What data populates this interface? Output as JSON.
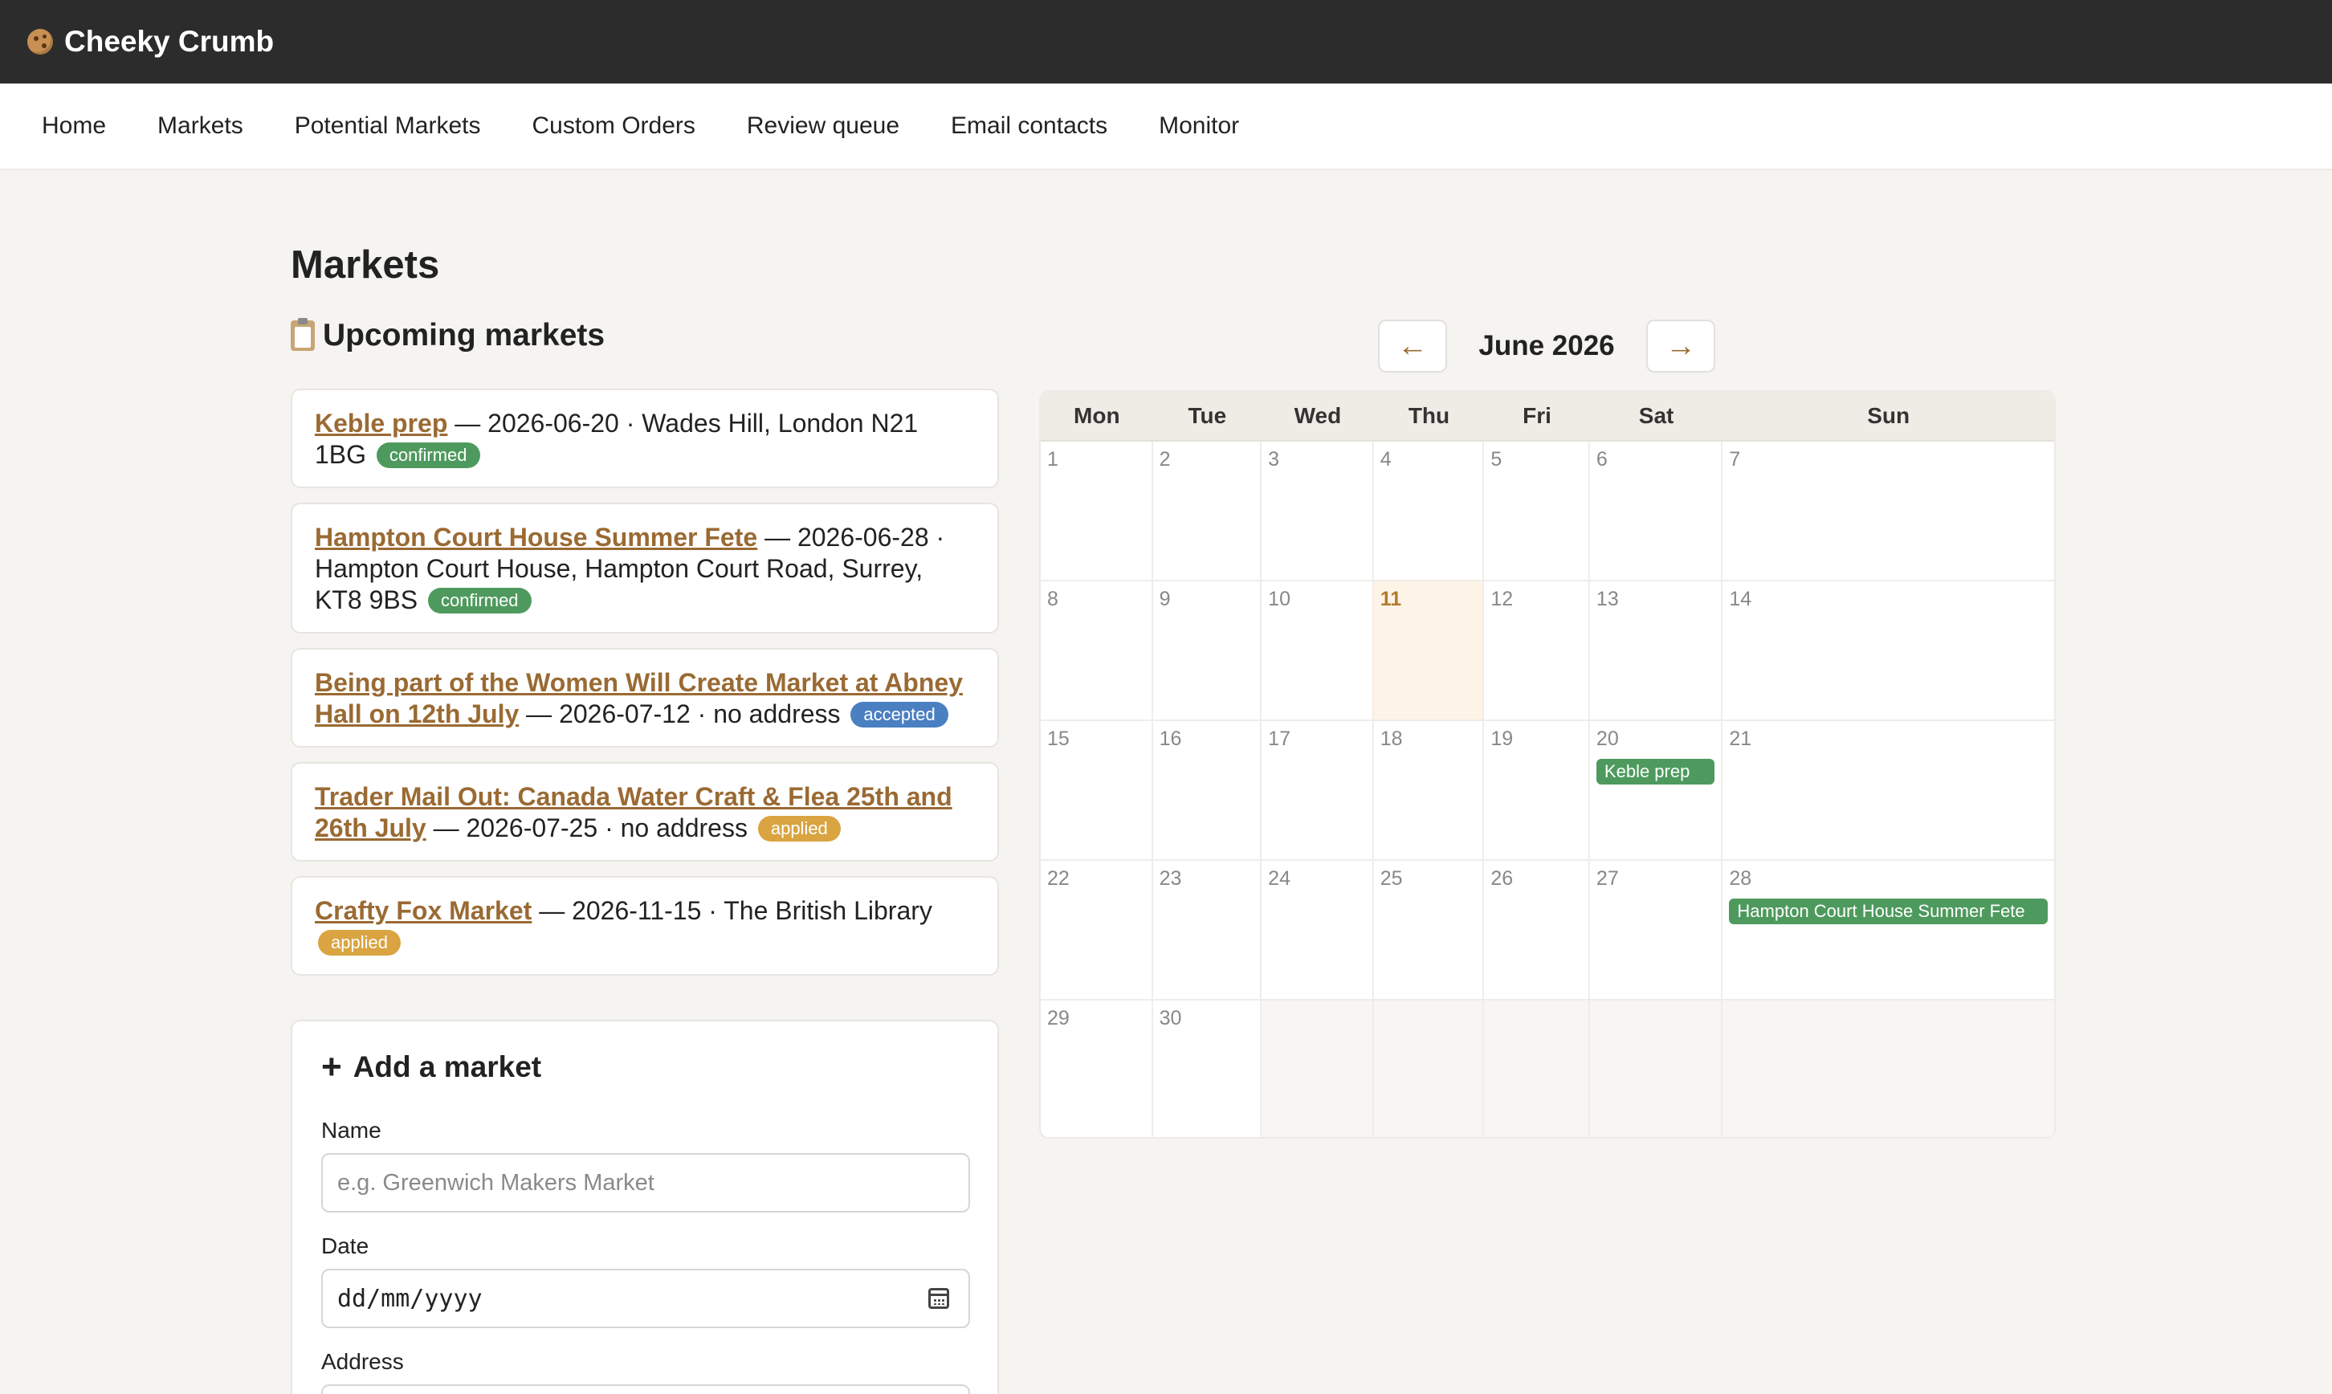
{
  "app": {
    "name": "Cheeky Crumb",
    "logo_icon": "cookie-icon"
  },
  "nav": {
    "items": [
      "Home",
      "Markets",
      "Potential Markets",
      "Custom Orders",
      "Review queue",
      "Email contacts",
      "Monitor"
    ]
  },
  "page": {
    "title": "Markets"
  },
  "upcoming": {
    "title": "Upcoming markets",
    "icon": "clipboard-icon",
    "markets": [
      {
        "name": "Keble prep",
        "detail": " — 2026-06-20 · Wades Hill, London N21 1BG",
        "status": "confirmed",
        "status_class": "confirmed"
      },
      {
        "name": "Hampton Court House Summer Fete",
        "detail": " — 2026-06-28 · Hampton Court House, Hampton Court Road, Surrey, KT8 9BS",
        "status": "confirmed",
        "status_class": "confirmed"
      },
      {
        "name": "Being part of the Women Will Create Market at Abney Hall on 12th July",
        "detail": " — 2026-07-12 · no address",
        "status": "accepted",
        "status_class": "accepted"
      },
      {
        "name": "Trader Mail Out: Canada Water Craft & Flea 25th and 26th July",
        "detail": " — 2026-07-25 · no address",
        "status": "applied",
        "status_class": "applied"
      },
      {
        "name": "Crafty Fox Market",
        "detail": " — 2026-11-15 · The British Library",
        "status": "applied",
        "status_class": "applied"
      }
    ],
    "status_colors": {
      "confirmed": "#4e9a5e",
      "accepted": "#4a7fc1",
      "applied": "#d9a441"
    }
  },
  "add_market": {
    "title": "Add a market",
    "icon": "plus-icon",
    "name_label": "Name",
    "name_placeholder": "e.g. Greenwich Makers Market",
    "date_label": "Date",
    "date_placeholder": "dd/mm/yyyy",
    "address_label": "Address"
  },
  "calendar": {
    "month_label": "June 2026",
    "prev_icon": "arrow-left-icon",
    "next_icon": "arrow-right-icon",
    "weekdays": [
      "Mon",
      "Tue",
      "Wed",
      "Thu",
      "Fri",
      "Sat",
      "Sun"
    ],
    "today": 11,
    "weeks": [
      [
        1,
        2,
        3,
        4,
        5,
        6,
        7
      ],
      [
        8,
        9,
        10,
        11,
        12,
        13,
        14
      ],
      [
        15,
        16,
        17,
        18,
        19,
        20,
        21
      ],
      [
        22,
        23,
        24,
        25,
        26,
        27,
        28
      ],
      [
        29,
        30,
        null,
        null,
        null,
        null,
        null
      ]
    ],
    "events": [
      {
        "day": 20,
        "label": "Keble prep"
      },
      {
        "day": 28,
        "label": "Hampton Court House Summer Fete"
      }
    ],
    "event_color": "#4e9a5e",
    "accent_color": "#9a6a33"
  }
}
